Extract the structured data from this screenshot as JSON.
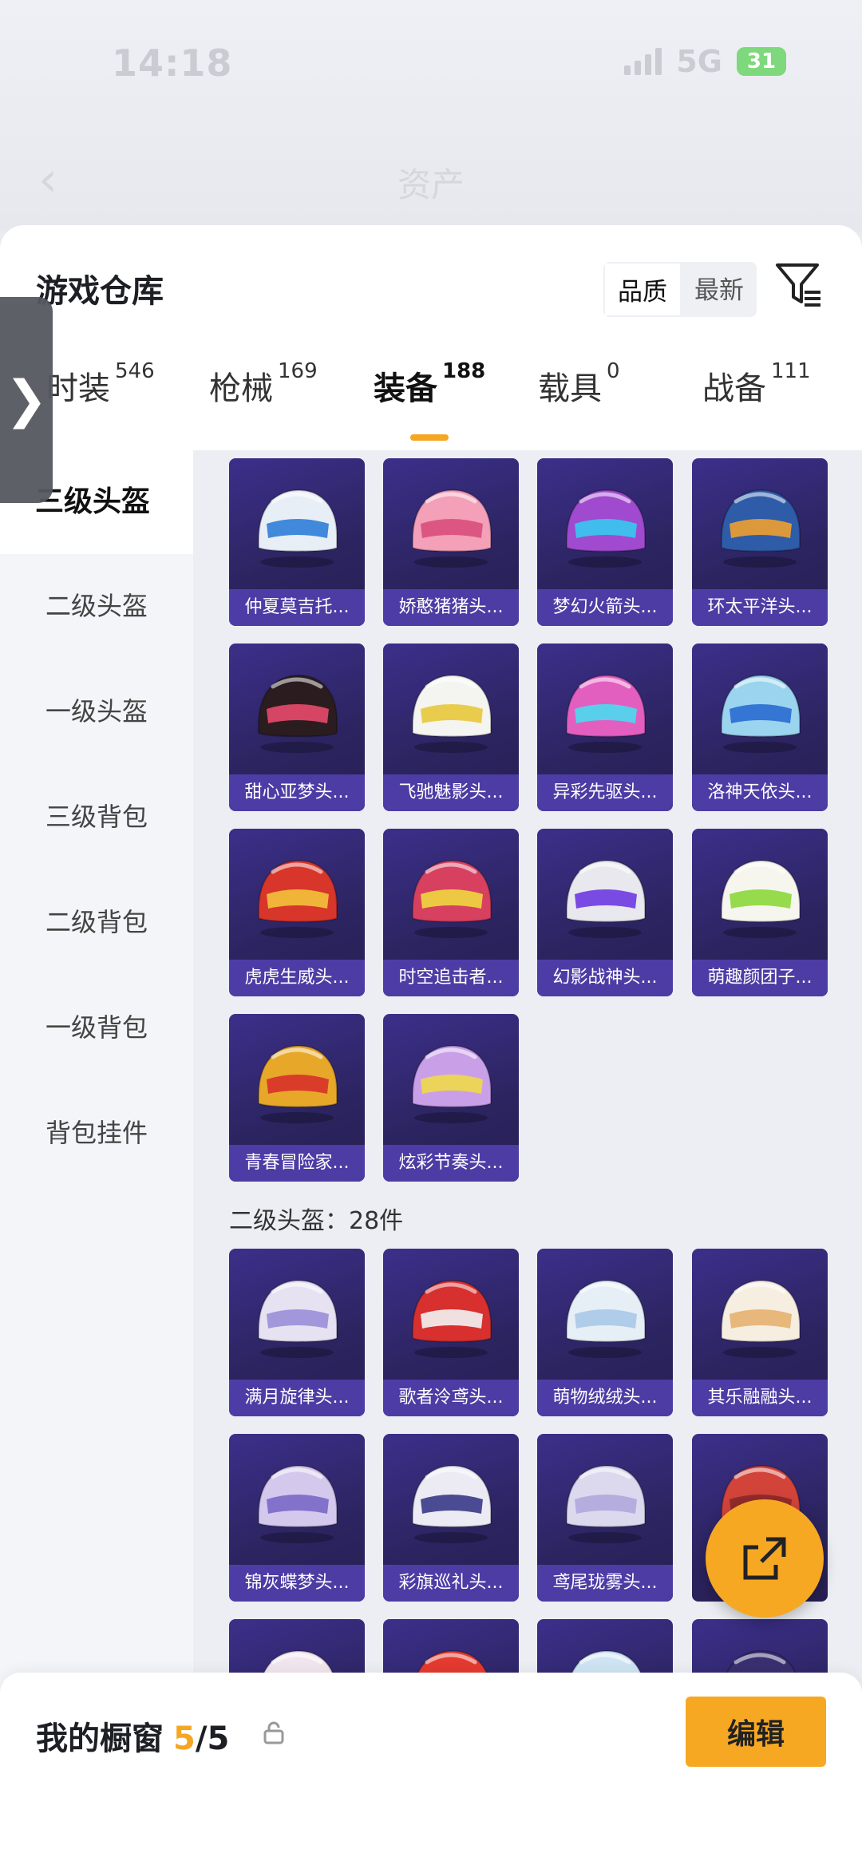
{
  "status_bar": {
    "time": "14:18",
    "network": "5G",
    "battery": "31"
  },
  "header": {
    "title": "资产"
  },
  "warehouse": {
    "title": "游戏仓库",
    "sort": {
      "quality": "品质",
      "latest": "最新"
    }
  },
  "tabs": [
    {
      "label": "时装",
      "count": "546"
    },
    {
      "label": "枪械",
      "count": "169"
    },
    {
      "label": "装备",
      "count": "188"
    },
    {
      "label": "载具",
      "count": "0"
    },
    {
      "label": "战备",
      "count": "111"
    }
  ],
  "sidebar": {
    "items": [
      {
        "label": "三级头盔"
      },
      {
        "label": "二级头盔"
      },
      {
        "label": "一级头盔"
      },
      {
        "label": "三级背包"
      },
      {
        "label": "二级背包"
      },
      {
        "label": "一级背包"
      },
      {
        "label": "背包挂件"
      }
    ]
  },
  "level3_items": [
    {
      "name": "仲夏莫吉托...",
      "color": "#e8eef6",
      "accent": "#2f7dd8"
    },
    {
      "name": "娇憨猪猪头...",
      "color": "#f3a0b8",
      "accent": "#d84f7c"
    },
    {
      "name": "梦幻火箭头...",
      "color": "#a04ad0",
      "accent": "#35c9f0"
    },
    {
      "name": "环太平洋头...",
      "color": "#2e5ca8",
      "accent": "#f0a030"
    },
    {
      "name": "甜心亚梦头...",
      "color": "#2b1d1f",
      "accent": "#e94a6a"
    },
    {
      "name": "飞驰魅影头...",
      "color": "#f4f4f0",
      "accent": "#e8c83a"
    },
    {
      "name": "异彩先驱头...",
      "color": "#e25fc0",
      "accent": "#4adcf0"
    },
    {
      "name": "洛神天依头...",
      "color": "#9ad4ee",
      "accent": "#2a6ad0"
    },
    {
      "name": "虎虎生威头...",
      "color": "#d8352b",
      "accent": "#f3c23a"
    },
    {
      "name": "时空追击者...",
      "color": "#d84060",
      "accent": "#f0d840"
    },
    {
      "name": "幻影战神头...",
      "color": "#e8e8ee",
      "accent": "#6e3ae0"
    },
    {
      "name": "萌趣颜团子...",
      "color": "#f6f6ee",
      "accent": "#8bd83a"
    },
    {
      "name": "青春冒险家...",
      "color": "#e7a82a",
      "accent": "#d8302a"
    },
    {
      "name": "炫彩节奏头...",
      "color": "#c9a0e8",
      "accent": "#f0d84a"
    }
  ],
  "section_level2": {
    "label": "二级头盔：28件"
  },
  "level2_items": [
    {
      "name": "满月旋律头...",
      "color": "#e6e2f2",
      "accent": "#9a8fd8"
    },
    {
      "name": "歌者泠鸢头...",
      "color": "#d8302e",
      "accent": "#f4f4f4"
    },
    {
      "name": "萌物绒绒头...",
      "color": "#e6eef6",
      "accent": "#a8c8e8"
    },
    {
      "name": "其乐融融头...",
      "color": "#f6eee0",
      "accent": "#e6b070"
    },
    {
      "name": "锦灰蝶梦头...",
      "color": "#d4c8ec",
      "accent": "#7a68c8"
    },
    {
      "name": "彩旗巡礼头...",
      "color": "#ecebf4",
      "accent": "#3a3a8a"
    },
    {
      "name": "鸢尾珑雾头...",
      "color": "#dcd8ee",
      "accent": "#b0a8dc"
    },
    {
      "name": "",
      "color": "#d2433a",
      "accent": "#8a2a2a"
    },
    {
      "name": "",
      "color": "#f2e6ee",
      "accent": "#e8a0b8"
    },
    {
      "name": "",
      "color": "#e43a30",
      "accent": "#f2c0b0"
    },
    {
      "name": "",
      "color": "#cfe4f2",
      "accent": "#8ab8e0"
    },
    {
      "name": "",
      "color": "#3a2f70",
      "accent": "#3a2f70"
    }
  ],
  "bottom_bar": {
    "title": "我的橱窗",
    "current": "5",
    "total": "/5",
    "edit": "编辑"
  }
}
